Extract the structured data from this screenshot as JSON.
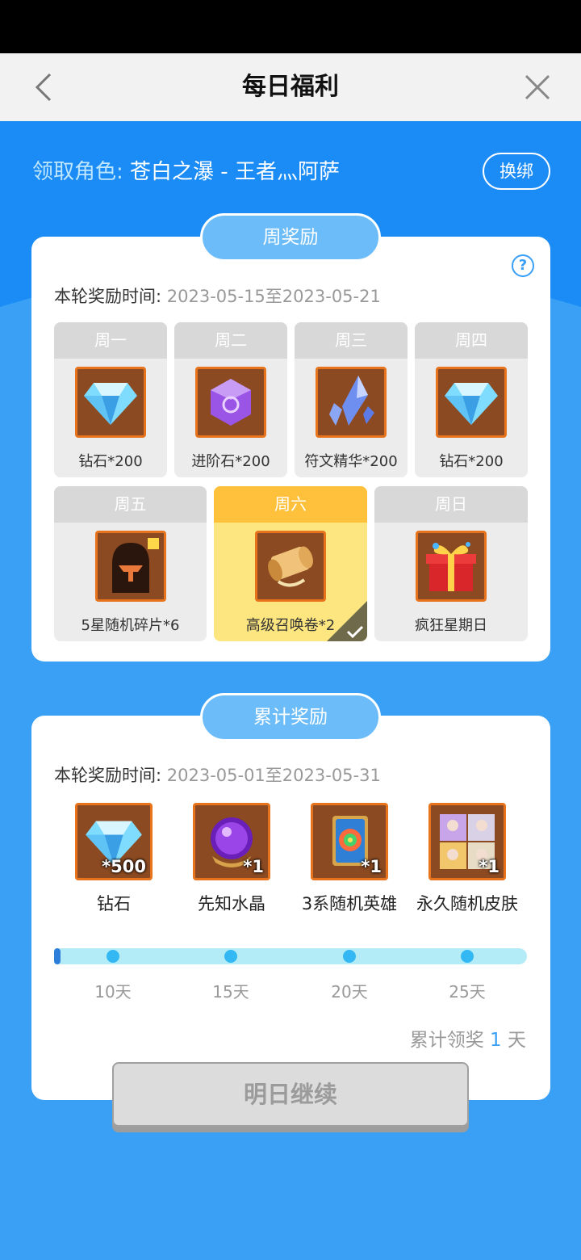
{
  "header": {
    "title": "每日福利",
    "back_icon": "chevron-left-icon",
    "close_icon": "close-icon"
  },
  "colors": {
    "primary": "#3aa0f5",
    "today": "#ffc13b",
    "item_bg": "#8b4a21",
    "item_border": "#e7741c"
  },
  "role": {
    "label": "领取角色: ",
    "name": "苍白之瀑 - 王者灬阿萨",
    "rebind_label": "换绑"
  },
  "weekly": {
    "tab_label": "周奖励",
    "help_label": "?",
    "period_label": "本轮奖励时间: ",
    "period_dates": "2023-05-15至2023-05-21",
    "days": [
      {
        "day": "周一",
        "item": "钻石*200",
        "icon": "diamond-icon"
      },
      {
        "day": "周二",
        "item": "进阶石*200",
        "icon": "advance-stone-icon"
      },
      {
        "day": "周三",
        "item": "符文精华*200",
        "icon": "rune-essence-icon"
      },
      {
        "day": "周四",
        "item": "钻石*200",
        "icon": "diamond-icon"
      },
      {
        "day": "周五",
        "item": "5星随机碎片*6",
        "icon": "hero-shard-icon"
      },
      {
        "day": "周六",
        "item": "高级召唤卷*2",
        "icon": "summon-scroll-icon",
        "today": true,
        "claimed": true
      },
      {
        "day": "周日",
        "item": "疯狂星期日",
        "icon": "gift-box-icon"
      }
    ]
  },
  "cumulative": {
    "tab_label": "累计奖励",
    "period_label": "本轮奖励时间: ",
    "period_dates": "2023-05-01至2023-05-31",
    "rewards": [
      {
        "name": "钻石",
        "count": "*500",
        "icon": "diamond-icon"
      },
      {
        "name": "先知水晶",
        "count": "*1",
        "icon": "prophet-crystal-icon"
      },
      {
        "name": "3系随机英雄",
        "count": "*1",
        "icon": "random-hero-card-icon"
      },
      {
        "name": "永久随机皮肤",
        "count": "*1",
        "icon": "random-skin-icon"
      }
    ],
    "milestones": [
      "10天",
      "15天",
      "20天",
      "25天"
    ],
    "progress_days": 1,
    "total_label_prefix": "累计领奖 ",
    "total_days": "1",
    "total_label_suffix": " 天"
  },
  "footer": {
    "button_label": "明日继续"
  }
}
